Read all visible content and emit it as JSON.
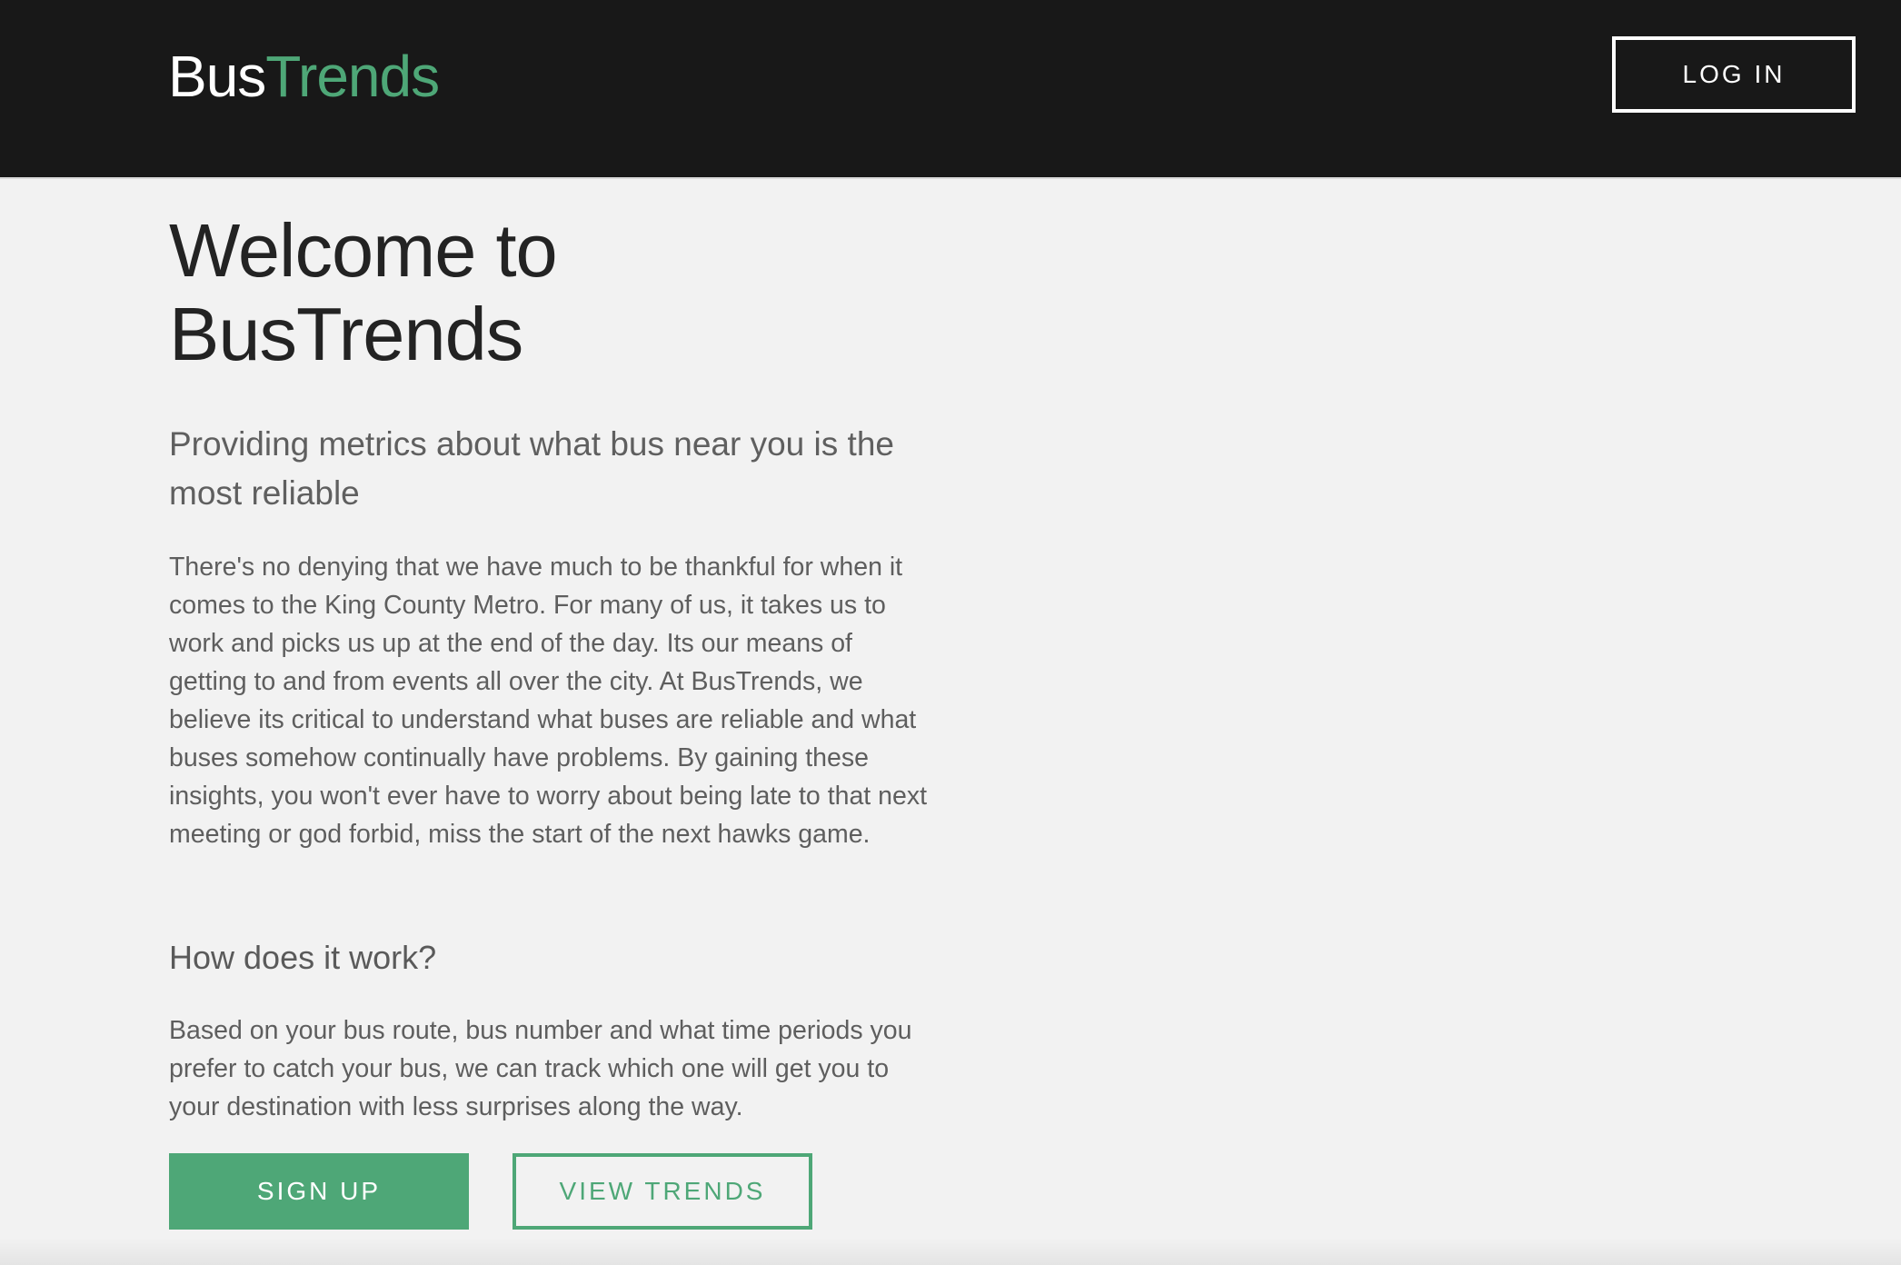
{
  "header": {
    "logo_part1": "Bus",
    "logo_part2": "Trends",
    "login_label": "LOG IN"
  },
  "hero": {
    "title_line1": "Welcome to",
    "title_line2": "BusTrends",
    "tagline": "Providing metrics about what bus near you is the most reliable",
    "body": "There's no denying that we have much to be thankful for when it comes to the King County Metro. For many of us, it takes us to work and picks us up at the end of the day. Its our means of getting to and from events all over the city. At BusTrends, we believe its critical to understand what buses are reliable and what buses somehow continually have problems. By gaining these insights, you won't ever have to worry about being late to that next meeting or god forbid, miss the start of the next hawks game."
  },
  "how": {
    "heading": "How does it work?",
    "body": "Based on your bus route, bus number and what time periods you prefer to catch your bus, we can track which one will get you to your destination with less surprises along the way."
  },
  "actions": {
    "signup_label": "SIGN UP",
    "view_trends_label": "VIEW TRENDS"
  },
  "colors": {
    "header_bg": "#181818",
    "accent": "#4ea777",
    "page_bg": "#f2f2f2"
  }
}
